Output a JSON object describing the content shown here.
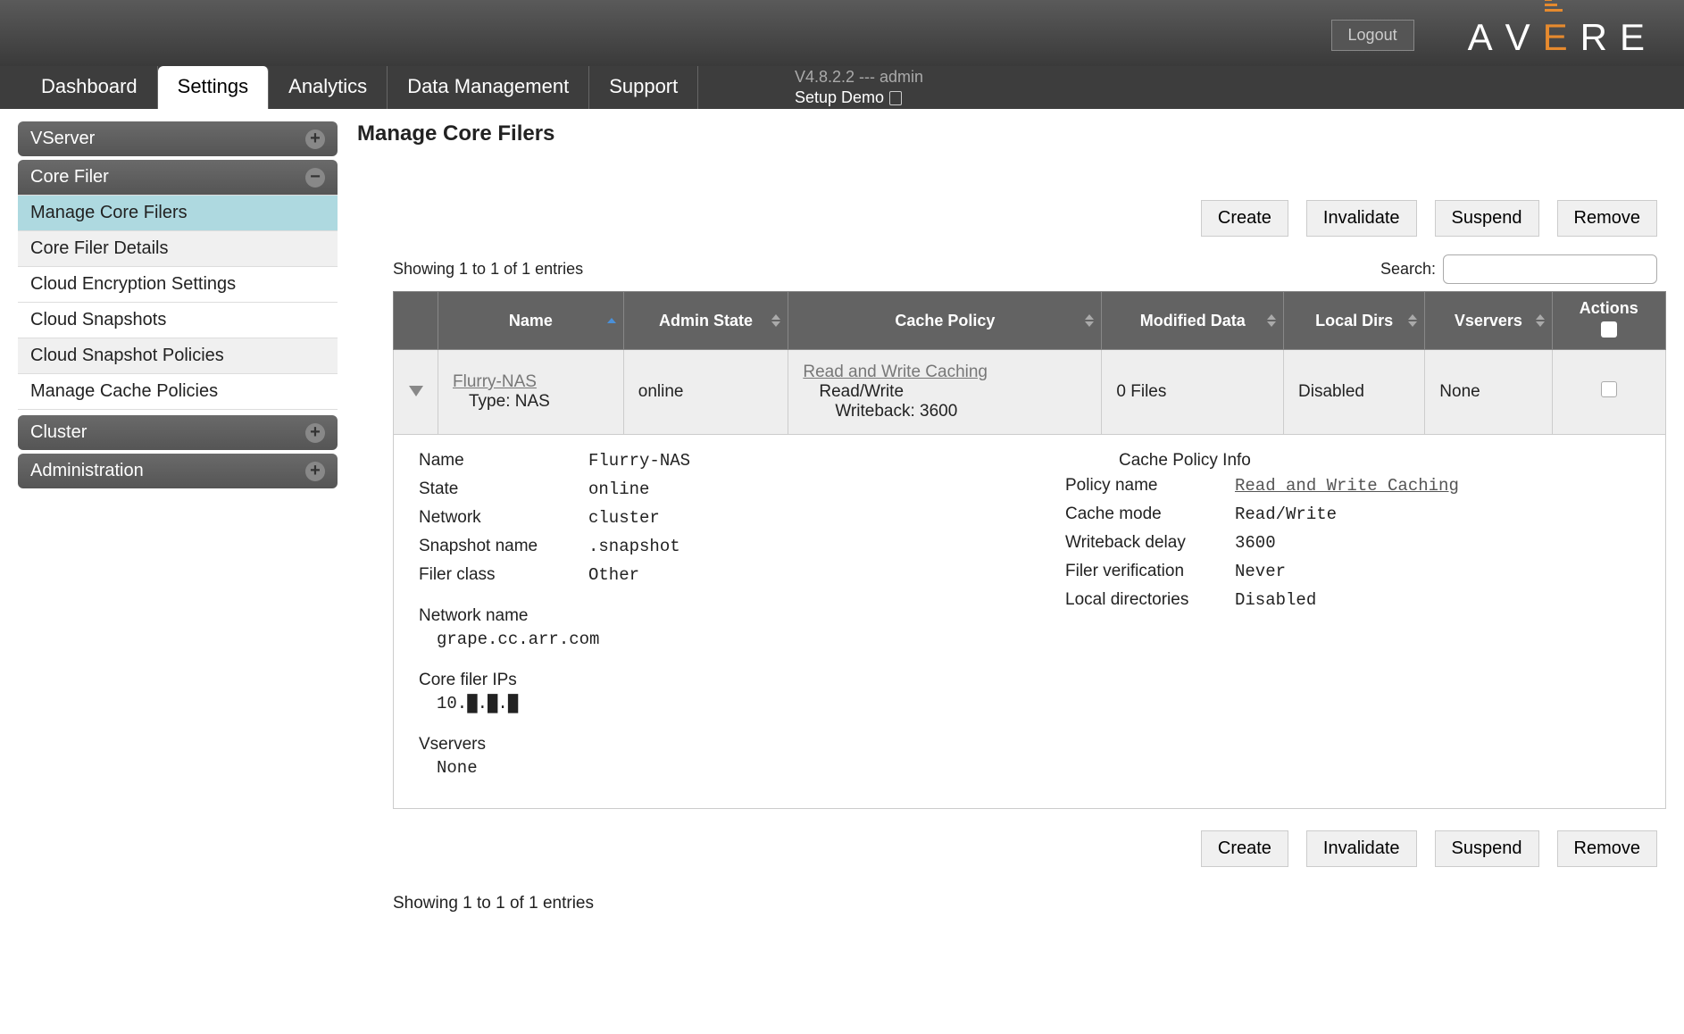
{
  "header": {
    "logout": "Logout",
    "logo_letters": [
      "A",
      "V",
      "E",
      "R",
      "E"
    ]
  },
  "tabs": {
    "items": [
      "Dashboard",
      "Settings",
      "Analytics",
      "Data Management",
      "Support"
    ],
    "active_index": 1
  },
  "version": {
    "line1": "V4.8.2.2 --- admin",
    "line2": "Setup Demo"
  },
  "sidebar": {
    "sections": [
      {
        "title": "VServer",
        "expanded": false
      },
      {
        "title": "Core Filer",
        "expanded": true,
        "items": [
          {
            "label": "Manage Core Filers",
            "active": true
          },
          {
            "label": "Core Filer Details",
            "active": false,
            "alt": true
          },
          {
            "label": "Cloud Encryption Settings",
            "active": false
          },
          {
            "label": "Cloud Snapshots",
            "active": false
          },
          {
            "label": "Cloud Snapshot Policies",
            "active": false,
            "alt": true
          },
          {
            "label": "Manage Cache Policies",
            "active": false
          }
        ]
      },
      {
        "title": "Cluster",
        "expanded": false
      },
      {
        "title": "Administration",
        "expanded": false
      }
    ]
  },
  "page": {
    "title": "Manage Core Filers",
    "showing": "Showing 1 to 1 of 1 entries",
    "search_label": "Search:"
  },
  "actions": {
    "create": "Create",
    "invalidate": "Invalidate",
    "suspend": "Suspend",
    "remove": "Remove"
  },
  "table": {
    "headers": {
      "name": "Name",
      "admin_state": "Admin State",
      "cache_policy": "Cache Policy",
      "modified_data": "Modified Data",
      "local_dirs": "Local Dirs",
      "vservers": "Vservers",
      "actions": "Actions"
    },
    "row": {
      "name": "Flurry-NAS",
      "name_sub": "Type: NAS",
      "admin_state": "online",
      "cache_policy_link": "Read and Write Caching",
      "cache_policy_l2": "Read/Write",
      "cache_policy_l3": "Writeback: 3600",
      "modified_data": "0 Files",
      "local_dirs": "Disabled",
      "vservers": "None"
    }
  },
  "details": {
    "left": {
      "name_lbl": "Name",
      "name_val": "Flurry-NAS",
      "state_lbl": "State",
      "state_val": "online",
      "network_lbl": "Network",
      "network_val": "cluster",
      "snapshot_lbl": "Snapshot name",
      "snapshot_val": ".snapshot",
      "filer_class_lbl": "Filer class",
      "filer_class_val": "Other",
      "net_name_lbl": "Network name",
      "net_name_val": "grape.cc.arr.com",
      "ips_lbl": "Core filer IPs",
      "ips_val": "10.█.█.█",
      "vservers_lbl": "Vservers",
      "vservers_val": "None"
    },
    "right": {
      "heading": "Cache Policy Info",
      "policy_name_lbl": "Policy name",
      "policy_name_val": "Read and Write Caching",
      "cache_mode_lbl": "Cache mode",
      "cache_mode_val": "Read/Write",
      "writeback_lbl": "Writeback delay",
      "writeback_val": "3600",
      "verification_lbl": "Filer verification",
      "verification_val": "Never",
      "local_dirs_lbl": "Local directories",
      "local_dirs_val": "Disabled"
    }
  }
}
